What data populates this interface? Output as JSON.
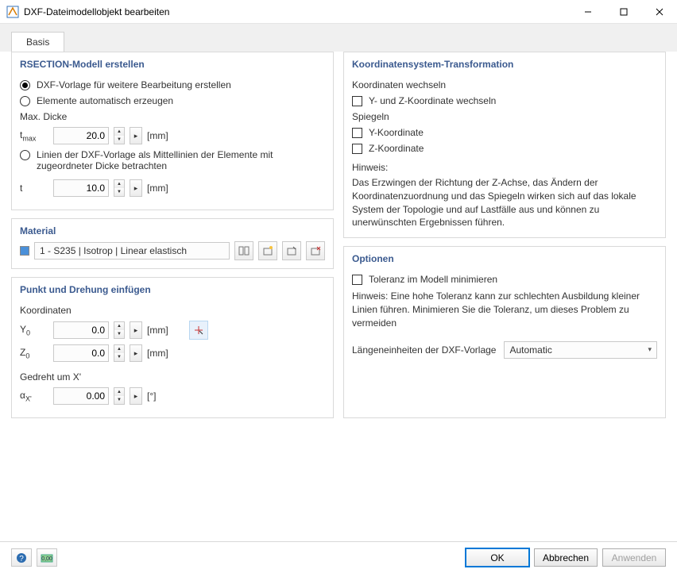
{
  "window": {
    "title": "DXF-Dateimodellobjekt bearbeiten"
  },
  "tabs": {
    "basic": "Basis"
  },
  "rsection": {
    "heading": "RSECTION-Modell erstellen",
    "opt_template": "DXF-Vorlage für weitere Bearbeitung erstellen",
    "opt_auto": "Elemente automatisch erzeugen",
    "max_thick_label": "Max. Dicke",
    "tmax_label": "t",
    "tmax_sub": "max",
    "tmax_value": "20.0",
    "unit_mm": "[mm]",
    "opt_centerlines": "Linien der DXF-Vorlage als Mittellinien der Elemente mit zugeordneter Dicke betrachten",
    "t_label": "t",
    "t_value": "10.0"
  },
  "material": {
    "heading": "Material",
    "value": "1 - S235 | Isotrop | Linear elastisch"
  },
  "insert": {
    "heading": "Punkt und Drehung einfügen",
    "coords_label": "Koordinaten",
    "y0_label": "Y",
    "y0_sub": "0",
    "y0_value": "0.0",
    "z0_label": "Z",
    "z0_sub": "0",
    "z0_value": "0.0",
    "rotated_label": "Gedreht um X'",
    "alpha_label": "α",
    "alpha_sub": "X'",
    "alpha_value": "0.00",
    "unit_deg": "[°]"
  },
  "csys": {
    "heading": "Koordinatensystem-Transformation",
    "swap_label": "Koordinaten wechseln",
    "swap_yz": "Y- und Z-Koordinate wechseln",
    "mirror_label": "Spiegeln",
    "mirror_y": "Y-Koordinate",
    "mirror_z": "Z-Koordinate",
    "hint_label": "Hinweis:",
    "hint_text": "Das Erzwingen der Richtung der Z-Achse, das Ändern der Koordinatenzuordnung und das Spiegeln wirken sich auf das lokale System der Topologie und auf Lastfälle aus und können zu unerwünschten Ergebnissen führen."
  },
  "options": {
    "heading": "Optionen",
    "min_tol": "Toleranz im Modell minimieren",
    "tol_hint": "Hinweis: Eine hohe Toleranz kann zur schlechten Ausbildung kleiner Linien führen. Minimieren Sie die Toleranz, um dieses Problem zu vermeiden",
    "length_units_label": "Längeneinheiten der DXF-Vorlage",
    "length_units_value": "Automatic"
  },
  "footer": {
    "ok": "OK",
    "cancel": "Abbrechen",
    "apply": "Anwenden"
  }
}
